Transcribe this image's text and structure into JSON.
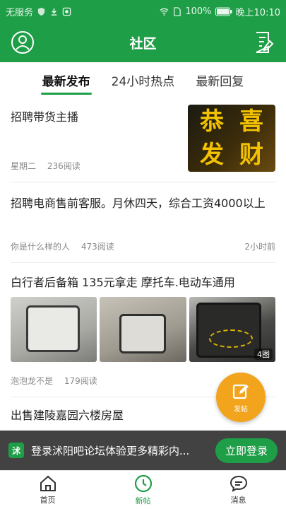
{
  "status_bar": {
    "carrier": "无服务",
    "battery": "100%",
    "time": "晚上10:10"
  },
  "header": {
    "title": "社区",
    "left_icon": "profile-icon",
    "right_icon": "compose-note-icon"
  },
  "tabs": [
    {
      "label": "最新发布",
      "active": true
    },
    {
      "label": "24小时热点",
      "active": false
    },
    {
      "label": "最新回复",
      "active": false
    }
  ],
  "posts": [
    {
      "title": "招聘带货主播",
      "thumb_text": [
        "恭",
        "喜",
        "发",
        "财"
      ],
      "author": "星期二",
      "reads": "236阅读"
    },
    {
      "title": "招聘电商售前客服。月休四天，综合工资4000以上",
      "author": "你是什么样的人",
      "reads": "473阅读",
      "time": "2小时前"
    },
    {
      "title": "白行者后备箱  135元拿走  摩托车.电动车通用",
      "author": "泡泡龙不是",
      "reads": "179阅读",
      "image_count": "4图"
    },
    {
      "title": "出售建陵嘉园六楼房屋"
    }
  ],
  "fab": {
    "label": "发帖",
    "icon": "edit-icon"
  },
  "banner": {
    "logo_text": "沭",
    "text": "登录沭阳吧论坛体验更多精彩内...",
    "button": "立即登录"
  },
  "bottom_nav": [
    {
      "label": "首页",
      "icon": "home-icon",
      "active": false
    },
    {
      "label": "新帖",
      "icon": "clock-icon",
      "active": true
    },
    {
      "label": "消息",
      "icon": "message-icon",
      "active": false
    }
  ],
  "colors": {
    "brand_green": "#1f9e48",
    "fab_orange": "#f2a41c"
  }
}
